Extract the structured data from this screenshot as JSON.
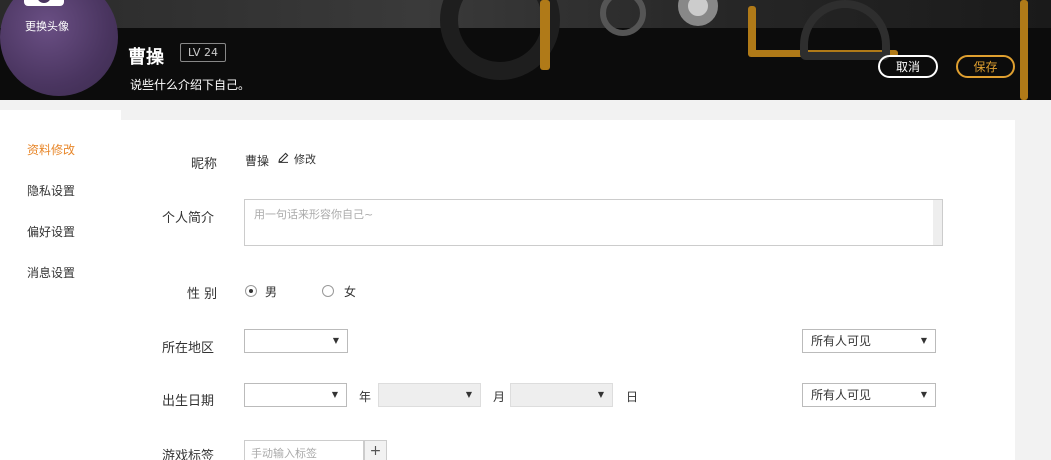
{
  "header": {
    "avatar_label": "更换头像",
    "username": "曹操",
    "level": "LV 24",
    "bio": "说些什么介绍下自己。",
    "cancel_label": "取消",
    "save_label": "保存"
  },
  "sidebar": {
    "items": [
      {
        "label": "资料修改",
        "active": true
      },
      {
        "label": "隐私设置",
        "active": false
      },
      {
        "label": "偏好设置",
        "active": false
      },
      {
        "label": "消息设置",
        "active": false
      }
    ]
  },
  "form": {
    "nickname": {
      "label": "昵称",
      "value": "曹操",
      "edit_label": "修改"
    },
    "bio": {
      "label": "个人简介",
      "placeholder": "用一句话来形容你自己~"
    },
    "gender": {
      "label": "性 别",
      "options": [
        {
          "label": "男",
          "checked": true
        },
        {
          "label": "女",
          "checked": false
        }
      ]
    },
    "region": {
      "label": "所在地区",
      "value": "",
      "visibility": "所有人可见"
    },
    "birthday": {
      "label": "出生日期",
      "year_value": "",
      "year_unit": "年",
      "month_value": "",
      "month_unit": "月",
      "day_value": "",
      "day_unit": "日",
      "visibility": "所有人可见"
    },
    "tags": {
      "label": "游戏标签",
      "placeholder": "手动输入标签",
      "add_label": "+"
    }
  },
  "colors": {
    "accent": "#e8872a",
    "save_border": "#e0a030",
    "avatar": "#4a3560"
  },
  "icons": {
    "avatar_change": "camera-icon",
    "edit": "pencil-icon",
    "dropdown": "caret-down-icon"
  }
}
